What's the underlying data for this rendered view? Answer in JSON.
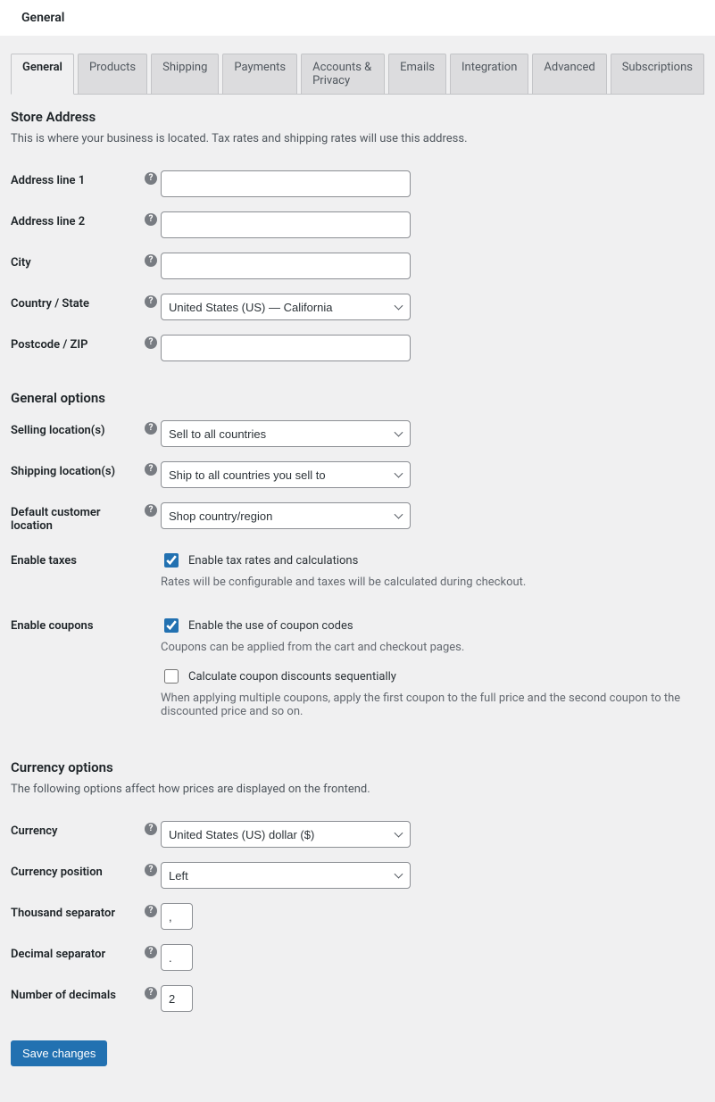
{
  "header": {
    "title": "General"
  },
  "tabs": [
    {
      "label": "General",
      "active": true
    },
    {
      "label": "Products"
    },
    {
      "label": "Shipping"
    },
    {
      "label": "Payments"
    },
    {
      "label": "Accounts & Privacy"
    },
    {
      "label": "Emails"
    },
    {
      "label": "Integration"
    },
    {
      "label": "Advanced"
    },
    {
      "label": "Subscriptions"
    }
  ],
  "store_address": {
    "title": "Store Address",
    "desc": "This is where your business is located. Tax rates and shipping rates will use this address.",
    "fields": {
      "address1_label": "Address line 1",
      "address1_value": "",
      "address2_label": "Address line 2",
      "address2_value": "",
      "city_label": "City",
      "city_value": "",
      "country_label": "Country / State",
      "country_value": "United States (US) — California",
      "postcode_label": "Postcode / ZIP",
      "postcode_value": ""
    }
  },
  "general_options": {
    "title": "General options",
    "selling_label": "Selling location(s)",
    "selling_value": "Sell to all countries",
    "shipping_label": "Shipping location(s)",
    "shipping_value": "Ship to all countries you sell to",
    "default_loc_label": "Default customer location",
    "default_loc_value": "Shop country/region",
    "enable_taxes_label": "Enable taxes",
    "enable_taxes_checkbox": "Enable tax rates and calculations",
    "enable_taxes_note": "Rates will be configurable and taxes will be calculated during checkout.",
    "enable_coupons_label": "Enable coupons",
    "enable_coupons_checkbox": "Enable the use of coupon codes",
    "enable_coupons_note": "Coupons can be applied from the cart and checkout pages.",
    "sequential_checkbox": "Calculate coupon discounts sequentially",
    "sequential_note": "When applying multiple coupons, apply the first coupon to the full price and the second coupon to the discounted price and so on."
  },
  "currency_options": {
    "title": "Currency options",
    "desc": "The following options affect how prices are displayed on the frontend.",
    "currency_label": "Currency",
    "currency_value": "United States (US) dollar ($)",
    "position_label": "Currency position",
    "position_value": "Left",
    "thousand_label": "Thousand separator",
    "thousand_value": ",",
    "decimal_label": "Decimal separator",
    "decimal_value": ".",
    "numdec_label": "Number of decimals",
    "numdec_value": "2"
  },
  "save_button": "Save changes"
}
